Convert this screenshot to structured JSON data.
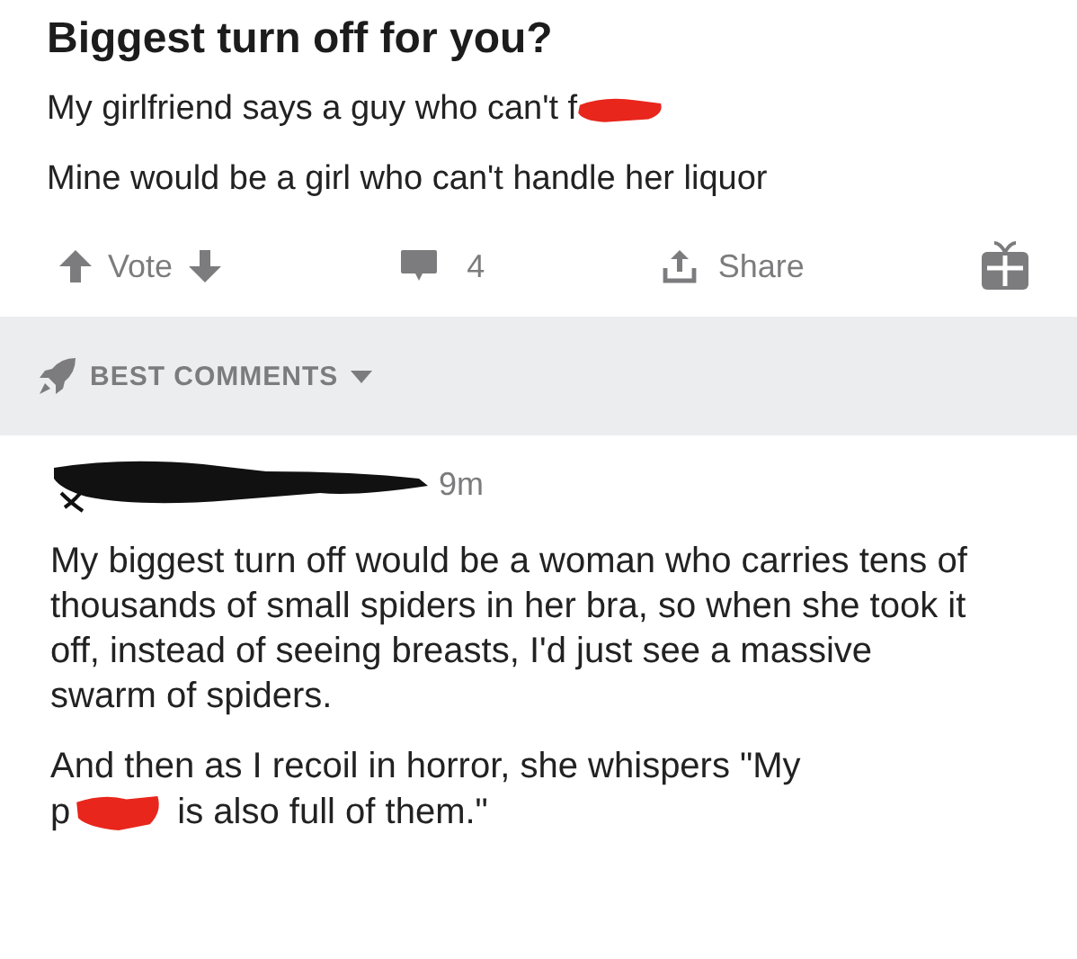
{
  "post": {
    "title": "Biggest turn off for you?",
    "lines": [
      {
        "text": "My girlfriend says a guy who can't f",
        "redacted_after": true
      },
      {
        "text": "Mine would be a girl who can't handle her liquor",
        "redacted_after": false
      }
    ]
  },
  "actions": {
    "vote": "Vote",
    "comments": "4",
    "share": "Share"
  },
  "sort": {
    "label": "BEST COMMENTS"
  },
  "comment": {
    "time": "9m",
    "author_redacted": true,
    "paragraphs": [
      {
        "text": "My biggest turn off would be a woman who carries tens of thousands of small spiders in her bra, so when she took it off, instead of seeing breasts, I'd just see a massive swarm of spiders."
      },
      {
        "text": "And then as I recoil in horror, she whispers \"My",
        "continuation_start": "p",
        "continuation_end": " is also full of them.\""
      }
    ]
  }
}
